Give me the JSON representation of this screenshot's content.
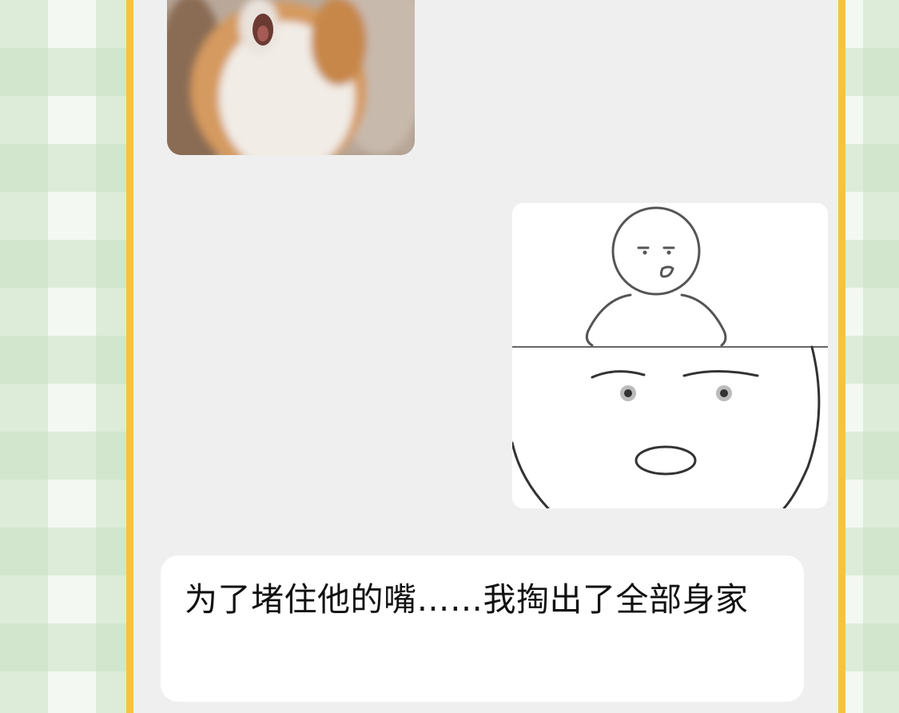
{
  "chat": {
    "messages": [
      {
        "sender": "other",
        "type": "image",
        "image_name": "screaming-hamster-sticker"
      },
      {
        "sender": "me",
        "type": "image",
        "image_name": "doodle-open-mouth-face-sticker"
      },
      {
        "sender": "other",
        "type": "text",
        "text": "为了堵住他的嘴……我掏出了全部身家"
      }
    ]
  },
  "colors": {
    "frame_border": "#f8c33a",
    "chat_background": "#efefef",
    "bubble_background": "#ffffff",
    "text": "#111111",
    "outer_plaid": "#c8e1c3"
  }
}
